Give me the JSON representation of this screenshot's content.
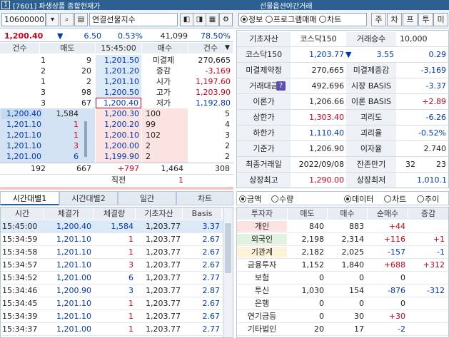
{
  "titlebar": {
    "code": "[7601]",
    "title": "파생상품 종합현재가",
    "right_title": "선물옵션야간거래",
    "icon": "1"
  },
  "toolbar": {
    "code_value": "10600000",
    "name_value": "연결선물지수",
    "radios": [
      {
        "label": "정보",
        "on": true
      },
      {
        "label": "프로그램매매",
        "on": false
      },
      {
        "label": "차트",
        "on": false
      }
    ],
    "buttons": [
      "주",
      "차",
      "프",
      "투",
      "미"
    ]
  },
  "price_bar": {
    "price": "1,200.40",
    "change": "6.50",
    "rate": "0.53%",
    "volume": "41,099",
    "ratio": "78.50%"
  },
  "orderbook": {
    "headers": [
      "건수",
      "매도",
      "15:45:00",
      "매수",
      "건수"
    ],
    "asks": [
      {
        "cnt": "1",
        "qty": "9",
        "price": "1,201.50"
      },
      {
        "cnt": "2",
        "qty": "20",
        "price": "1,201.20"
      },
      {
        "cnt": "1",
        "qty": "2",
        "price": "1,201.10"
      },
      {
        "cnt": "3",
        "qty": "98",
        "price": "1,200.50"
      },
      {
        "cnt": "3",
        "qty": "67",
        "price": "1,200.40"
      }
    ],
    "info": [
      {
        "label": "미결제",
        "value": "270,665",
        "color": "#222"
      },
      {
        "label": "증감",
        "value": "-3,169",
        "color": "#0038b8"
      },
      {
        "label": "시가",
        "value": "1,197.60",
        "color": "#0038b8"
      },
      {
        "label": "고가",
        "value": "1,203.90",
        "color": "#d8001c"
      },
      {
        "label": "저가",
        "value": "1,192.80",
        "color": "#0038b8"
      }
    ],
    "ticks": [
      {
        "price": "1,200.40",
        "qty": "1,584"
      },
      {
        "price": "1,201.10",
        "qty": "1"
      },
      {
        "price": "1,201.10",
        "qty": "1"
      },
      {
        "price": "1,201.10",
        "qty": "3"
      },
      {
        "price": "1,201.00",
        "qty": "6"
      }
    ],
    "bids": [
      {
        "price": "1,200.30",
        "qty": "100",
        "cnt": "5"
      },
      {
        "price": "1,200.20",
        "qty": "99",
        "cnt": "4"
      },
      {
        "price": "1,200.10",
        "qty": "102",
        "cnt": "3"
      },
      {
        "price": "1,200.00",
        "qty": "2",
        "cnt": "2"
      },
      {
        "price": "1,199.90",
        "qty": "2",
        "cnt": "2"
      }
    ],
    "totals": {
      "ask_cnt": "192",
      "ask_qty": "667",
      "diff": "+797",
      "bid_qty": "1,464",
      "bid_cnt": "308"
    },
    "last": {
      "label": "직전",
      "value": "1"
    }
  },
  "tabs": [
    "시간대별1",
    "시간대별2",
    "일간",
    "차트"
  ],
  "time_table": {
    "headers": [
      "시간",
      "체결가",
      "체결량",
      "기초자산",
      "Basis"
    ],
    "rows": [
      [
        "15:45:00",
        "1,200.40",
        "1,584",
        "1,203.77",
        "3.37"
      ],
      [
        "15:34:59",
        "1,201.10",
        "1",
        "1,203.77",
        "2.67"
      ],
      [
        "15:34:58",
        "1,201.10",
        "1",
        "1,203.77",
        "2.67"
      ],
      [
        "15:34:57",
        "1,201.10",
        "3",
        "1,203.77",
        "2.67"
      ],
      [
        "15:34:52",
        "1,201.00",
        "6",
        "1,203.77",
        "2.77"
      ],
      [
        "15:34:46",
        "1,200.90",
        "3",
        "1,203.77",
        "2.87"
      ],
      [
        "15:34:45",
        "1,201.10",
        "1",
        "1,203.77",
        "2.67"
      ],
      [
        "15:34:39",
        "1,201.10",
        "1",
        "1,203.77",
        "2.67"
      ],
      [
        "15:34:37",
        "1,201.00",
        "1",
        "1,203.77",
        "2.77"
      ]
    ],
    "vol_colors": [
      "blue",
      "red",
      "red",
      "red",
      "blue",
      "blue",
      "red",
      "red",
      "red"
    ]
  },
  "info_table": {
    "top": {
      "l1": "기초자산",
      "v1": "코스닥150",
      "l2": "거래승수",
      "v2": "10,000"
    },
    "rows": [
      {
        "l1": "코스닥150",
        "v1": "1,203.77",
        "v1c": "#0038b8",
        "l2": "",
        "v2": "3.55",
        "v2c": "#0038b8",
        "v3": "0.29",
        "v3c": "#0038b8",
        "arrow": true
      },
      {
        "l1": "미결제약정",
        "v1": "270,665",
        "v1c": "#222",
        "l2": "미결제증감",
        "v2": "-3,169",
        "v2c": "#0038b8"
      },
      {
        "l1": "거래대금",
        "v1": "492,696",
        "v1c": "#222",
        "l2": "시장 BASIS",
        "v2": "-3.37",
        "v2c": "#0038b8",
        "q": true
      },
      {
        "l1": "이론가",
        "v1": "1,206.66",
        "v1c": "#222",
        "l2": "이론 BASIS",
        "v2": "+2.89",
        "v2c": "#d8001c"
      },
      {
        "l1": "상한가",
        "v1": "1,303.40",
        "v1c": "#d8001c",
        "l2": "괴리도",
        "v2": "-6.26",
        "v2c": "#0038b8"
      },
      {
        "l1": "하한가",
        "v1": "1,110.40",
        "v1c": "#0038b8",
        "l2": "괴리율",
        "v2": "-0.52%",
        "v2c": "#0038b8"
      },
      {
        "l1": "기준가",
        "v1": "1,206.90",
        "v1c": "#222",
        "l2": "이자율",
        "v2": "2.740",
        "v2c": "#222"
      },
      {
        "l1": "최종거래일",
        "v1": "2022/09/08",
        "v1c": "#222",
        "l2": "잔존만기",
        "v2a": "32",
        "v2": "23",
        "v2c": "#222"
      },
      {
        "l1": "상장최고",
        "v1": "1,290.00",
        "v1c": "#d8001c",
        "l2": "상장최저",
        "v2": "1,010.10",
        "v2c": "#0038b8"
      }
    ],
    "q_label": "?"
  },
  "investor": {
    "radios_left": [
      {
        "label": "금액",
        "on": true
      },
      {
        "label": "수량",
        "on": false
      }
    ],
    "radios_right": [
      {
        "label": "데이터",
        "on": true
      },
      {
        "label": "차트",
        "on": false
      },
      {
        "label": "추이",
        "on": false
      }
    ],
    "headers": [
      "투자자",
      "매도",
      "매수",
      "순매수",
      "증감"
    ],
    "rows": [
      [
        "개인",
        "840",
        "883",
        "+44",
        ""
      ],
      [
        "외국인",
        "2,198",
        "2,314",
        "+116",
        "+1"
      ],
      [
        "기관계",
        "2,182",
        "2,025",
        "-157",
        "-1"
      ],
      [
        "금융투자",
        "1,152",
        "1,840",
        "+688",
        "+312"
      ],
      [
        "보험",
        "0",
        "0",
        "0",
        ""
      ],
      [
        "투신",
        "1,030",
        "154",
        "-876",
        "-312"
      ],
      [
        "은행",
        "0",
        "0",
        "0",
        ""
      ],
      [
        "연기금등",
        "0",
        "30",
        "+30",
        ""
      ],
      [
        "기타법인",
        "20",
        "17",
        "-2",
        ""
      ]
    ],
    "name_bg": [
      "#fbe3e1",
      "#e3f2e0",
      "#fdf3d8",
      "#fff",
      "#fff",
      "#fff",
      "#fff",
      "#fff",
      "#fff"
    ]
  },
  "colors": {
    "accent": "#2c5f92",
    "up": "#d8001c",
    "down": "#0038b8",
    "ask_bg": "#dce9f7",
    "bid_bg": "#fbe3e1"
  }
}
